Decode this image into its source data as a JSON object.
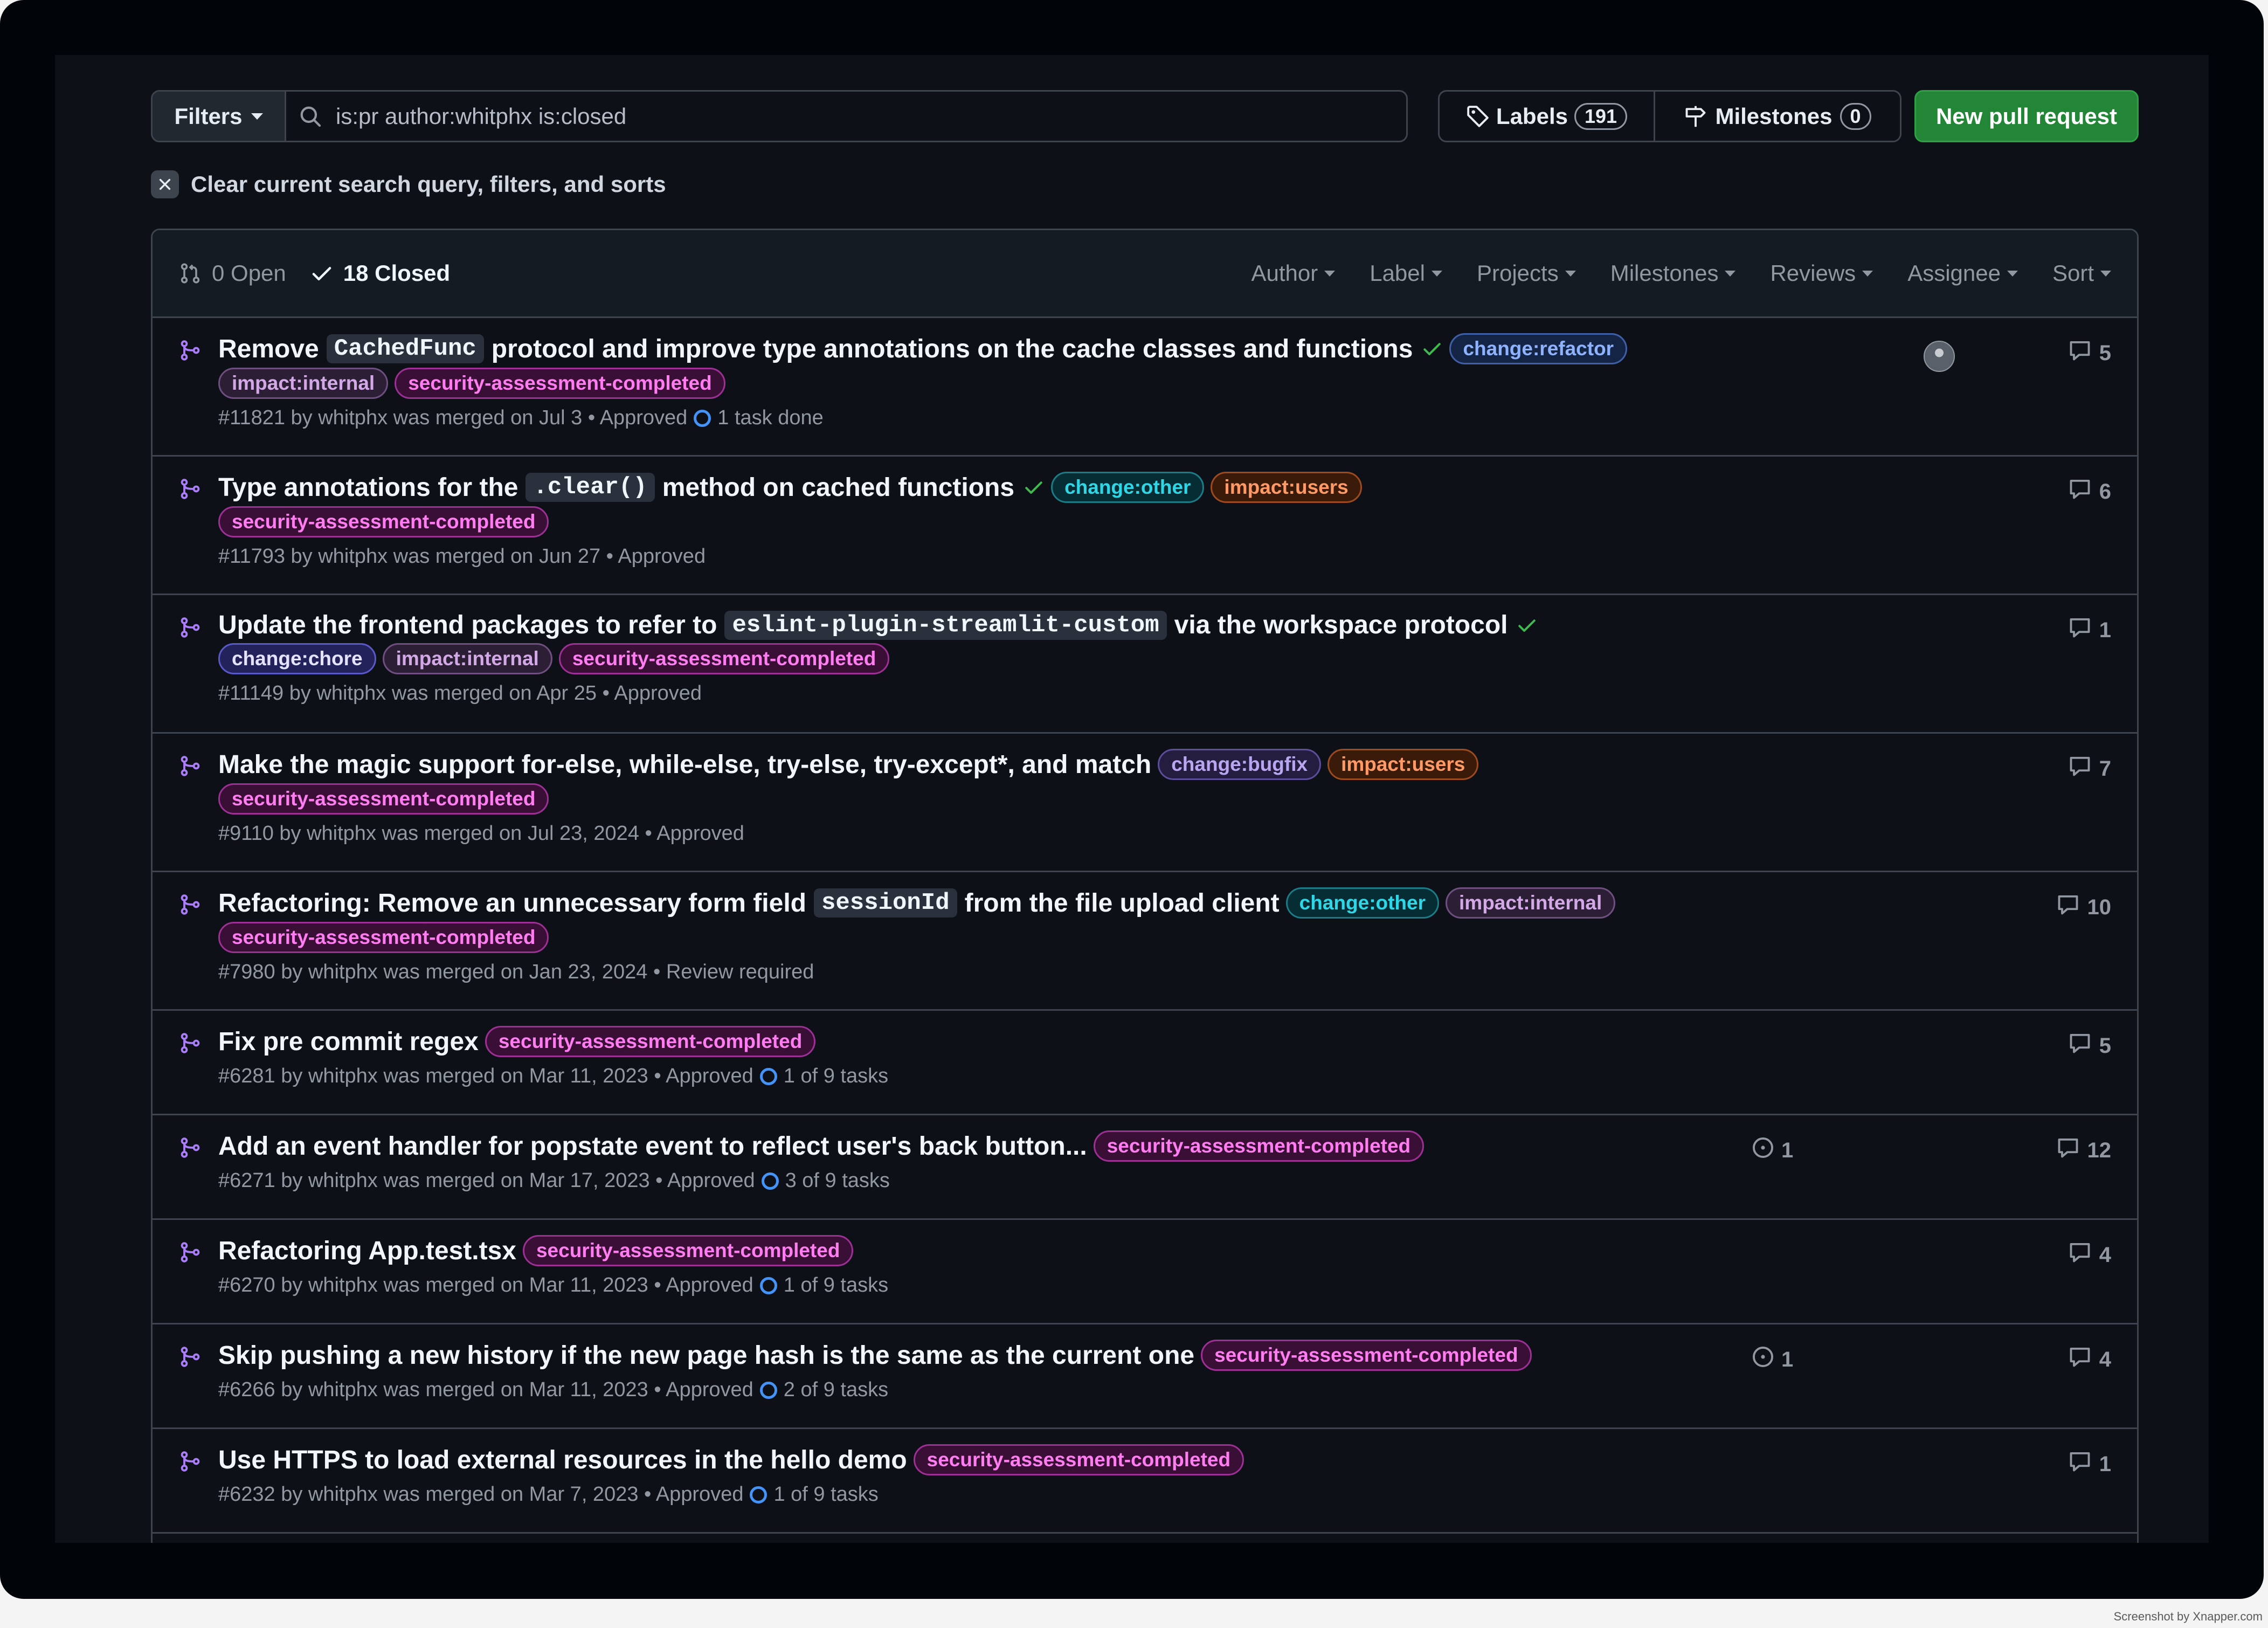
{
  "search": {
    "filters_label": "Filters",
    "query": "is:pr author:whitphx is:closed"
  },
  "toolbar": {
    "labels_label": "Labels",
    "labels_count": "191",
    "milestones_label": "Milestones",
    "milestones_count": "0",
    "new_pr_label": "New pull request"
  },
  "clear_query_label": "Clear current search query, filters, and sorts",
  "list_header": {
    "open_label": "0 Open",
    "closed_label": "18 Closed",
    "menus": [
      "Author",
      "Label",
      "Projects",
      "Milestones",
      "Reviews",
      "Assignee",
      "Sort"
    ]
  },
  "label_colors": {
    "change:refactor": {
      "text": "#8fb2ff",
      "border": "#3f5fa8",
      "bg": "#132445"
    },
    "impact:internal": {
      "text": "#d2a8e6",
      "border": "#6e4f80",
      "bg": "#2c1f35"
    },
    "security-assessment-completed": {
      "text": "#ff7df0",
      "border": "#9d2f95",
      "bg": "#3a0f36"
    },
    "change:other": {
      "text": "#2fd6e6",
      "border": "#1b7b86",
      "bg": "#062d33"
    },
    "impact:users": {
      "text": "#ff9a66",
      "border": "#9c4a1e",
      "bg": "#3a1a08"
    },
    "change:chore": {
      "text": "#e4e3ff",
      "border": "#5a59c8",
      "bg": "#23225a"
    },
    "change:bugfix": {
      "text": "#b9a6f0",
      "border": "#5c4e99",
      "bg": "#241d40"
    }
  },
  "pull_requests": [
    {
      "title_parts": [
        {
          "t": "Remove "
        },
        {
          "code": "CachedFunc"
        },
        {
          "t": " protocol and improve type annotations on the cache classes and functions"
        }
      ],
      "check": true,
      "inline_labels": [
        "change:refactor"
      ],
      "second_labels": [
        "impact:internal",
        "security-assessment-completed"
      ],
      "meta": "#11821 by whitphx was merged on Jul 3 • Approved",
      "task": "1 task done",
      "comments": "5",
      "avatar": true
    },
    {
      "title_parts": [
        {
          "t": "Type annotations for the "
        },
        {
          "code": ".clear()"
        },
        {
          "t": " method on cached functions"
        }
      ],
      "check": true,
      "inline_labels": [
        "change:other",
        "impact:users"
      ],
      "second_labels": [
        "security-assessment-completed"
      ],
      "meta": "#11793 by whitphx was merged on Jun 27 • Approved",
      "comments": "6"
    },
    {
      "title_parts": [
        {
          "t": "Update the frontend packages to refer to "
        },
        {
          "code": "eslint-plugin-streamlit-custom"
        },
        {
          "t": " via the workspace protocol"
        }
      ],
      "check": true,
      "inline_labels": [],
      "second_labels": [
        "change:chore",
        "impact:internal",
        "security-assessment-completed"
      ],
      "meta": "#11149 by whitphx was merged on Apr 25 • Approved",
      "comments": "1"
    },
    {
      "title_parts": [
        {
          "t": "Make the magic support for-else, while-else, try-else, try-except*, and match"
        }
      ],
      "check": false,
      "inline_labels": [
        "change:bugfix",
        "impact:users"
      ],
      "second_labels": [
        "security-assessment-completed"
      ],
      "meta": "#9110 by whitphx was merged on Jul 23, 2024 • Approved",
      "comments": "7"
    },
    {
      "title_parts": [
        {
          "t": "Refactoring: Remove an unnecessary form field "
        },
        {
          "code": "sessionId"
        },
        {
          "t": " from the file upload client"
        }
      ],
      "check": false,
      "inline_labels": [
        "change:other",
        "impact:internal"
      ],
      "second_labels": [
        "security-assessment-completed"
      ],
      "meta": "#7980 by whitphx was merged on Jan 23, 2024 • Review required",
      "comments": "10"
    },
    {
      "title_parts": [
        {
          "t": "Fix pre commit regex"
        }
      ],
      "check": false,
      "inline_labels": [
        "security-assessment-completed"
      ],
      "second_labels": [],
      "meta": "#6281 by whitphx was merged on Mar 11, 2023 • Approved",
      "task": "1 of 9 tasks",
      "comments": "5"
    },
    {
      "title_parts": [
        {
          "t": "Add an event handler for popstate event to reflect user's back button..."
        }
      ],
      "check": false,
      "inline_labels": [
        "security-assessment-completed"
      ],
      "second_labels": [],
      "meta": "#6271 by whitphx was merged on Mar 17, 2023 • Approved",
      "task": "3 of 9 tasks",
      "linked": "1",
      "comments": "12"
    },
    {
      "title_parts": [
        {
          "t": "Refactoring App.test.tsx"
        }
      ],
      "check": false,
      "inline_labels": [
        "security-assessment-completed"
      ],
      "second_labels": [],
      "meta": "#6270 by whitphx was merged on Mar 11, 2023 • Approved",
      "task": "1 of 9 tasks",
      "comments": "4"
    },
    {
      "title_parts": [
        {
          "t": "Skip pushing a new history if the new page hash is the same as the current one"
        }
      ],
      "check": false,
      "inline_labels": [
        "security-assessment-completed"
      ],
      "second_labels": [],
      "meta": "#6266 by whitphx was merged on Mar 11, 2023 • Approved",
      "task": "2 of 9 tasks",
      "linked": "1",
      "comments": "4"
    },
    {
      "title_parts": [
        {
          "t": "Use HTTPS to load external resources in the hello demo"
        }
      ],
      "check": false,
      "inline_labels": [
        "security-assessment-completed"
      ],
      "second_labels": [],
      "meta": "#6232 by whitphx was merged on Mar 7, 2023 • Approved",
      "task": "1 of 9 tasks",
      "comments": "1"
    }
  ],
  "credit": "Screenshot by Xnapper.com"
}
